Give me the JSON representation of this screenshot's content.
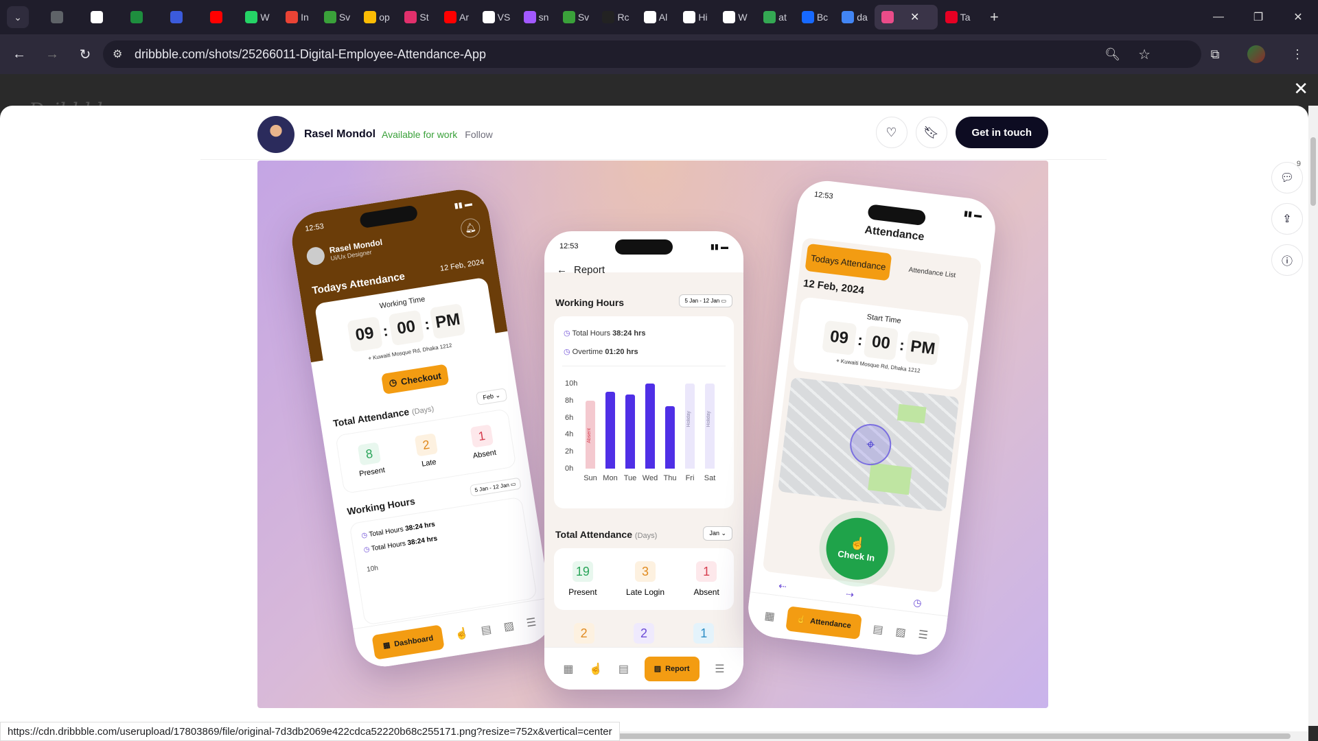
{
  "browser": {
    "tabs": [
      {
        "icon": "globe-icon",
        "label": "",
        "color": "#5f6368"
      },
      {
        "icon": "google-icon",
        "label": "",
        "color": "#ffffff"
      },
      {
        "icon": "leaf-icon",
        "label": "",
        "color": "#1e8e3e"
      },
      {
        "icon": "signal-icon",
        "label": "",
        "color": "#3b5bdb"
      },
      {
        "icon": "youtube-icon",
        "label": "",
        "color": "#ff0000"
      },
      {
        "icon": "whatsapp-icon",
        "label": "W",
        "color": "#25d366"
      },
      {
        "icon": "gmail-icon",
        "label": "In",
        "color": "#ea4335"
      },
      {
        "icon": "green-circle-icon",
        "label": "Sv",
        "color": "#3aa13a"
      },
      {
        "icon": "google-play-icon",
        "label": "op",
        "color": "#fbbc04"
      },
      {
        "icon": "instagram-icon",
        "label": "St",
        "color": "#e1306c"
      },
      {
        "icon": "youtube-icon",
        "label": "Ar",
        "color": "#ff0000"
      },
      {
        "icon": "github-icon",
        "label": "VS",
        "color": "#ffffff"
      },
      {
        "icon": "figma-like-icon",
        "label": "sn",
        "color": "#a259ff"
      },
      {
        "icon": "green-circle-icon",
        "label": "Sv",
        "color": "#3aa13a"
      },
      {
        "icon": "triangle-icon",
        "label": "Rc",
        "color": "#222222"
      },
      {
        "icon": "openai-icon",
        "label": "Al",
        "color": "#ffffff"
      },
      {
        "icon": "github-icon",
        "label": "Hi",
        "color": "#ffffff"
      },
      {
        "icon": "wikipedia-icon",
        "label": "W",
        "color": "#ffffff"
      },
      {
        "icon": "play-store-icon",
        "label": "at",
        "color": "#34a853"
      },
      {
        "icon": "behance-icon",
        "label": "Bc",
        "color": "#1769ff"
      },
      {
        "icon": "google-icon",
        "label": "da",
        "color": "#4285f4"
      },
      {
        "icon": "dribbble-icon",
        "label": "",
        "color": "#ea4c89",
        "active": true
      },
      {
        "icon": "pinterest-icon",
        "label": "Ta",
        "color": "#e60023"
      }
    ],
    "url": "dribbble.com/shots/25266011-Digital-Employee-Attendance-App",
    "status_url": "https://cdn.dribbble.com/userupload/17803869/file/original-7d3db2069e422cdca52220b68c255171.png?resize=752x&vertical=center"
  },
  "shot": {
    "designer_name": "Rasel Mondol",
    "availability": "Available for work",
    "follow_label": "Follow",
    "cta_label": "Get in touch",
    "comments_count": "9"
  },
  "phone_left": {
    "time": "12:53",
    "user_name": "Rasel Mondol",
    "user_role": "Ui/Ux Designer",
    "date": "12 Feb, 2024",
    "section_title": "Todays Attendance",
    "working_time_label": "Working Time",
    "hours": "09",
    "minutes": "00",
    "ampm": "PM",
    "location": "Kuwaiti Mosque Rd, Dhaka 1212",
    "checkout_label": "Checkout",
    "total_attendance_title": "Total Attendance",
    "days_label": "(Days)",
    "month_select": "Feb",
    "present_value": "8",
    "present_label": "Present",
    "late_value": "2",
    "late_label": "Late",
    "absent_value": "1",
    "absent_label": "Absent",
    "working_hours_title": "Working Hours",
    "range": "5 Jan - 12 Jan",
    "total_hours_label": "Total Hours",
    "total_hours_value": "38:24 hrs",
    "total_hours_label_2": "Total Hours",
    "total_hours_value_2": "38:24 hrs",
    "chart_tick": "10h",
    "nav_active": "Dashboard"
  },
  "phone_mid": {
    "time": "12:53",
    "title": "Report",
    "working_hours_title": "Working Hours",
    "range": "5 Jan - 12 Jan",
    "total_hours_label": "Total Hours",
    "total_hours_value": "38:24 hrs",
    "overtime_label": "Overtime",
    "overtime_value": "01:20 hrs",
    "total_attendance_title": "Total Attendance",
    "days_label": "(Days)",
    "month_select": "Jan",
    "present_value": "19",
    "present_label": "Present",
    "late_value": "3",
    "late_label": "Late Login",
    "absent_value": "1",
    "absent_label": "Absent",
    "extra_values": [
      "2",
      "2",
      "1"
    ],
    "nav_active": "Report"
  },
  "phone_right": {
    "time": "12:53",
    "title": "Attendance",
    "tab_active": "Todays Attendance",
    "tab_inactive": "Attendance List",
    "date": "12 Feb, 2024",
    "start_time_label": "Start Time",
    "hours": "09",
    "minutes": "00",
    "ampm": "PM",
    "location": "Kuwaiti Mosque Rd, Dhaka 1212",
    "checkin_label": "Check In",
    "nav_active": "Attendance"
  },
  "chart_data": {
    "type": "bar",
    "categories": [
      "Sun",
      "Mon",
      "Tue",
      "Wed",
      "Thu",
      "Fri",
      "Sat"
    ],
    "values": [
      8,
      9,
      8.7,
      10,
      7.3,
      10,
      10
    ],
    "status": [
      "Absent",
      "",
      "",
      "",
      "",
      "Holiday",
      "Holiday"
    ],
    "ylim": [
      0,
      10
    ],
    "yticks": [
      "0h",
      "2h",
      "4h",
      "6h",
      "8h",
      "10h"
    ],
    "colors": {
      "worked": "#4f2fe6",
      "absent": "#f4c9cf",
      "holiday": "#ebe7fb"
    }
  }
}
